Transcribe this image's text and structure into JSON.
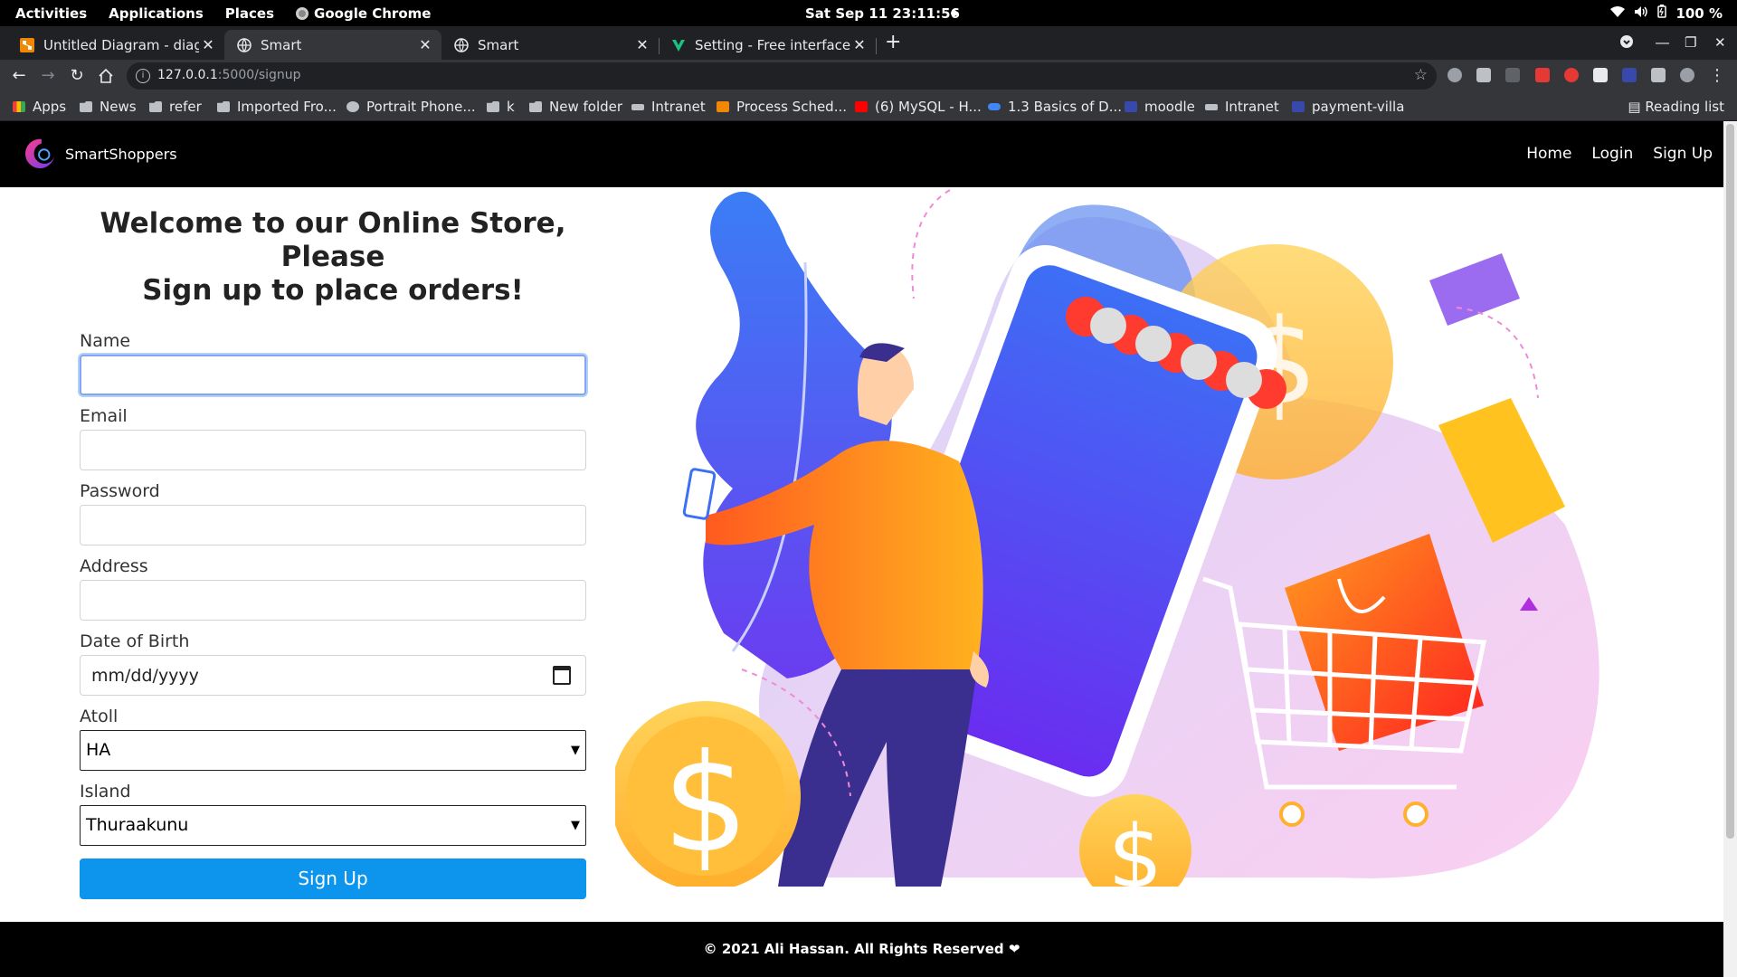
{
  "system_bar": {
    "activities": "Activities",
    "applications": "Applications",
    "places": "Places",
    "app_name": "Google Chrome",
    "clock": "Sat Sep 11  23:11:56",
    "battery": "100 %"
  },
  "tabs": [
    {
      "title": "Untitled Diagram - diagra",
      "active": false
    },
    {
      "title": "Smart",
      "active": true
    },
    {
      "title": "Smart",
      "active": false
    },
    {
      "title": "Setting - Free interface icc",
      "active": false
    }
  ],
  "address_bar": {
    "host": "127.0.0.1",
    "path": ":5000/signup"
  },
  "bookmarks": [
    {
      "label": "Apps",
      "icon": "apps-grid-icon"
    },
    {
      "label": "News",
      "icon": "folder-icon"
    },
    {
      "label": "refer",
      "icon": "folder-icon"
    },
    {
      "label": "Imported Fro...",
      "icon": "folder-icon"
    },
    {
      "label": "Portrait Phone...",
      "icon": "globe-icon"
    },
    {
      "label": "k",
      "icon": "folder-icon"
    },
    {
      "label": "New folder",
      "icon": "folder-icon"
    },
    {
      "label": "Intranet",
      "icon": "keyboard-icon"
    },
    {
      "label": "Process Sched...",
      "icon": "fox-icon"
    },
    {
      "label": "(6) MySQL - H...",
      "icon": "youtube-icon"
    },
    {
      "label": "1.3 Basics of D...",
      "icon": "infinity-icon"
    },
    {
      "label": "moodle",
      "icon": "moodle-icon"
    },
    {
      "label": "Intranet",
      "icon": "keyboard-icon"
    },
    {
      "label": "payment-villa",
      "icon": "moodle-icon"
    }
  ],
  "reading_list": "Reading list",
  "site": {
    "brand": "SmartShoppers",
    "nav": [
      "Home",
      "Login",
      "Sign Up"
    ],
    "heading_line1": "Welcome to our Online Store, Please",
    "heading_line2": "Sign up to place orders!",
    "form": {
      "name_label": "Name",
      "name_value": "",
      "email_label": "Email",
      "email_value": "",
      "password_label": "Password",
      "password_value": "",
      "address_label": "Address",
      "address_value": "",
      "dob_label": "Date of Birth",
      "dob_placeholder": "mm/dd/yyyy",
      "atoll_label": "Atoll",
      "atoll_value": "HA",
      "island_label": "Island",
      "island_value": "Thuraakunu",
      "submit_label": "Sign Up"
    },
    "footer": "© 2021 Ali Hassan. All Rights Reserved ❤"
  },
  "colors": {
    "accent": "#0d95ee",
    "nav_bg": "#000000",
    "illus_blue": "#4a6cf7",
    "illus_orange": "#ff8a1f",
    "illus_pink": "#f3a9e8",
    "illus_gold": "#ffc233"
  }
}
